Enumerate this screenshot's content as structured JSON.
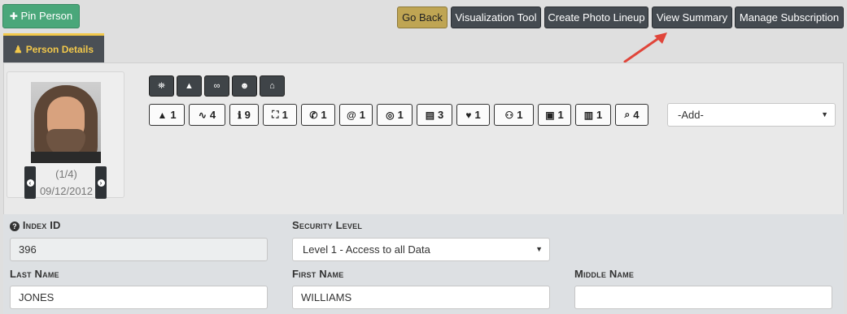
{
  "toolbar": {
    "pin_label": "Pin Person",
    "go_back": "Go Back",
    "visualization": "Visualization Tool",
    "photo_lineup": "Create Photo Lineup",
    "view_summary": "View Summary",
    "manage_subscription": "Manage Subscription"
  },
  "tab": {
    "label": "Person Details"
  },
  "photo": {
    "count": "(1/4)",
    "date": "09/12/2012"
  },
  "quick_icons": [
    "map-marker-icon",
    "warning-icon",
    "link-icon",
    "user-secret-icon",
    "bank-icon"
  ],
  "counters": [
    {
      "icon": "warning-icon",
      "glyph": "▲",
      "value": "1"
    },
    {
      "icon": "signature-icon",
      "glyph": "∿",
      "value": "4"
    },
    {
      "icon": "info-icon",
      "glyph": "ℹ",
      "value": "9"
    },
    {
      "icon": "map-icon",
      "glyph": "⛶",
      "value": "1"
    },
    {
      "icon": "phone-icon",
      "glyph": "✆",
      "value": "1"
    },
    {
      "icon": "at-icon",
      "glyph": "@",
      "value": "1"
    },
    {
      "icon": "target-icon",
      "glyph": "◎",
      "value": "1"
    },
    {
      "icon": "id-card-icon",
      "glyph": "▤",
      "value": "3"
    },
    {
      "icon": "heart-icon",
      "glyph": "♥",
      "value": "1"
    },
    {
      "icon": "users-icon",
      "glyph": "⚇",
      "value": "1"
    },
    {
      "icon": "briefcase-icon",
      "glyph": "▣",
      "value": "1"
    },
    {
      "icon": "building-icon",
      "glyph": "▥",
      "value": "1"
    },
    {
      "icon": "paperclip-icon",
      "glyph": "⌕",
      "value": "4"
    }
  ],
  "add_select": {
    "value": "-Add-"
  },
  "form": {
    "index_id_label": "Index ID",
    "index_id_value": "396",
    "security_label": "Security Level",
    "security_value": "Level 1 - Access to all Data",
    "last_name_label": "Last Name",
    "last_name_value": "JONES",
    "first_name_label": "First Name",
    "first_name_value": "WILLIAMS",
    "middle_name_label": "Middle Name",
    "middle_name_value": ""
  },
  "colors": {
    "accent_gold": "#f2c84b",
    "dark_button": "#444a50",
    "green": "#4aa77a",
    "annotation_arrow": "#e0453a"
  }
}
